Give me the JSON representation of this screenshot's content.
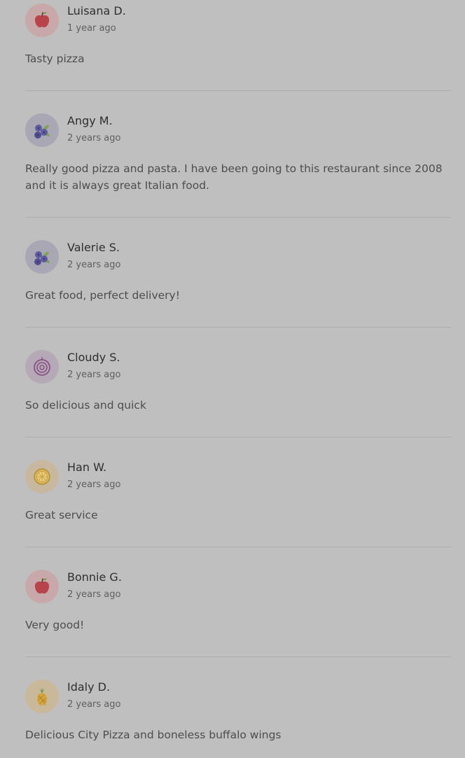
{
  "reviews": [
    {
      "name": "Luisana D.",
      "time": "1 year ago",
      "text": "Tasty pizza",
      "avatar_icon": "apple-icon",
      "avatar_bg": "#c8a8a8"
    },
    {
      "name": "Angy M.",
      "time": "2 years ago",
      "text": "Really good pizza and pasta. I have been going to this restaurant since 2008 and it is always great Italian food.",
      "avatar_icon": "blueberries-icon",
      "avatar_bg": "#a9a7b3"
    },
    {
      "name": "Valerie S.",
      "time": "2 years ago",
      "text": "Great food, perfect delivery!",
      "avatar_icon": "blueberries-icon",
      "avatar_bg": "#a9a7b3"
    },
    {
      "name": "Cloudy S.",
      "time": "2 years ago",
      "text": "So delicious and quick",
      "avatar_icon": "onion-icon",
      "avatar_bg": "#b5a9b5"
    },
    {
      "name": "Han W.",
      "time": "2 years ago",
      "text": "Great service",
      "avatar_icon": "lemon-icon",
      "avatar_bg": "#c9b8a0"
    },
    {
      "name": "Bonnie G.",
      "time": "2 years ago",
      "text": "Very good!",
      "avatar_icon": "apple-icon",
      "avatar_bg": "#c8a8a8"
    },
    {
      "name": "Idaly D.",
      "time": "2 years ago",
      "text": "Delicious City Pizza and boneless buffalo wings",
      "avatar_icon": "pineapple-icon",
      "avatar_bg": "#c9b89a"
    }
  ]
}
